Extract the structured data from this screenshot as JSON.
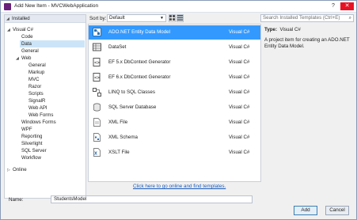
{
  "window": {
    "title": "Add New Item - MVCWebApplication"
  },
  "titlebar": {
    "help": "?",
    "close": "✕"
  },
  "tree": {
    "root": "Installed",
    "items": [
      {
        "label": "Visual C#",
        "expanded": true
      },
      {
        "label": "Code"
      },
      {
        "label": "Data",
        "selected": true
      },
      {
        "label": "General"
      },
      {
        "label": "Web",
        "expanded": true
      },
      {
        "label": "General"
      },
      {
        "label": "Markup"
      },
      {
        "label": "MVC"
      },
      {
        "label": "Razor"
      },
      {
        "label": "Scripts"
      },
      {
        "label": "SignalR"
      },
      {
        "label": "Web API"
      },
      {
        "label": "Web Forms"
      },
      {
        "label": "Windows Forms"
      },
      {
        "label": "WPF"
      },
      {
        "label": "Reporting"
      },
      {
        "label": "Silverlight"
      },
      {
        "label": "SQL Server"
      },
      {
        "label": "Workflow"
      }
    ],
    "online": "Online"
  },
  "toolbar": {
    "sort_label": "Sort by:",
    "sort_value": "Default",
    "search_placeholder": "Search Installed Templates (Ctrl+E)"
  },
  "templates": [
    {
      "name": "ADO.NET Entity Data Model",
      "lang": "Visual C#",
      "selected": true,
      "icon": "entity-model-icon"
    },
    {
      "name": "DataSet",
      "lang": "Visual C#",
      "icon": "dataset-icon"
    },
    {
      "name": "EF 5.x DbContext Generator",
      "lang": "Visual C#",
      "icon": "ef-generator-icon"
    },
    {
      "name": "EF 6.x DbContext Generator",
      "lang": "Visual C#",
      "icon": "ef-generator-icon"
    },
    {
      "name": "LINQ to SQL Classes",
      "lang": "Visual C#",
      "icon": "linq-icon"
    },
    {
      "name": "SQL Server Database",
      "lang": "Visual C#",
      "icon": "database-icon"
    },
    {
      "name": "XML File",
      "lang": "Visual C#",
      "icon": "xml-file-icon"
    },
    {
      "name": "XML Schema",
      "lang": "Visual C#",
      "icon": "xml-schema-icon"
    },
    {
      "name": "XSLT File",
      "lang": "Visual C#",
      "icon": "xslt-file-icon"
    }
  ],
  "info": {
    "type_label": "Type:",
    "type_value": "Visual C#",
    "description": "A project item for creating an ADO.NET Entity Data Model."
  },
  "online_link": "Click here to go online and find templates.",
  "name_label": "Name:",
  "name_value": "StudentsModel",
  "buttons": {
    "add": "Add",
    "cancel": "Cancel"
  },
  "colors": {
    "selection": "#3399ff",
    "tree_selection": "#cce4f7",
    "link": "#1a5bbb"
  }
}
